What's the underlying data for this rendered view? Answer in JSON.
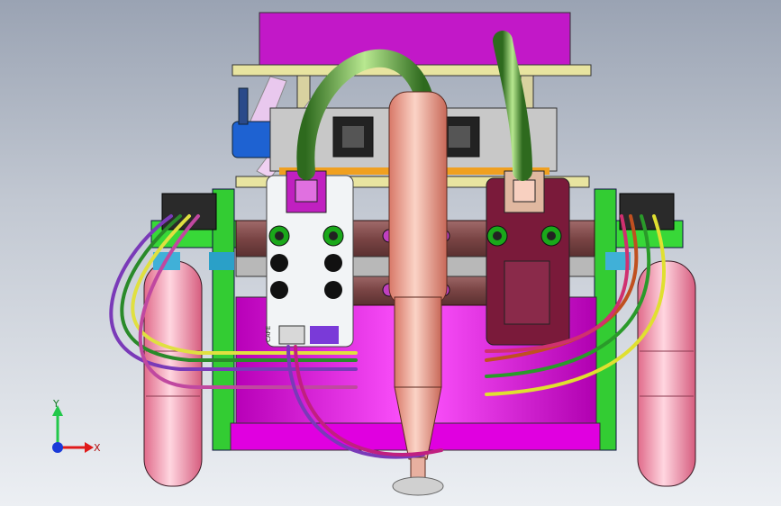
{
  "viewport": {
    "background_top": "#9aa3b3",
    "background_bottom": "#eceff3"
  },
  "model": {
    "board_labels": [
      "CAFE",
      "CAFE"
    ],
    "colors": {
      "chassis_magenta": "#e000e0",
      "frame_green": "#22cc22",
      "wheel_pink": "#f08aa8",
      "pen_copper": "#f0a090",
      "board_white": "#f2f4f6",
      "board_maroon": "#7a1a3a",
      "top_plate": "#c818c8",
      "pcb_yellow": "#e8e4a0"
    }
  },
  "triad": {
    "y_label": "Y",
    "x_label": "X",
    "y_color": "#22c84a",
    "x_color": "#e01a1a",
    "origin_color": "#1a3ad8"
  }
}
